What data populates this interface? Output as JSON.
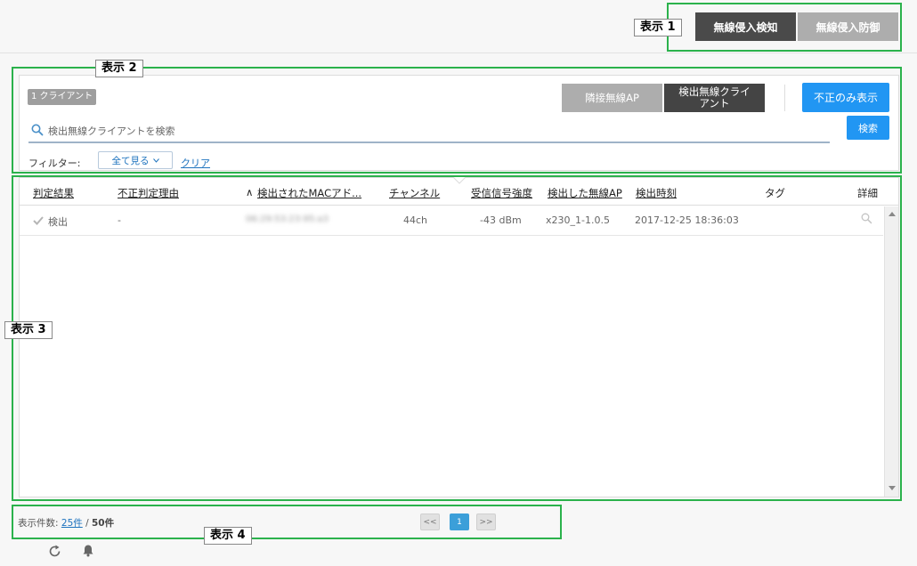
{
  "callouts": {
    "c1": "表示 1",
    "c2": "表示 2",
    "c3": "表示 3",
    "c4": "表示 4"
  },
  "header": {
    "ids_button": "無線侵入検知",
    "ips_button": "無線侵入防御"
  },
  "search_panel": {
    "client_count": "1 クライアント",
    "tab_neighbor_ap": "隣接無線AP",
    "tab_detected_client": "検出無線クライアント",
    "rogue_only_button": "不正のみ表示",
    "search_placeholder": "検出無線クライアントを検索",
    "search_button": "検索",
    "filter_label": "フィルター:",
    "filter_value": "全て見る",
    "clear_link": "クリア"
  },
  "table": {
    "columns": [
      "判定結果",
      "不正判定理由",
      "検出されたMACアド...",
      "チャンネル",
      "受信信号強度",
      "検出した無線AP",
      "検出時刻",
      "タグ",
      "詳細"
    ],
    "sort_indicator": "∧",
    "rows": [
      {
        "result": "検出",
        "reason": "-",
        "mac": "06:29:53:23:95:a3",
        "channel": "44ch",
        "rssi": "-43 dBm",
        "ap": "x230_1-1.0.5",
        "time": "2017-12-25 18:36:03"
      }
    ]
  },
  "footer": {
    "per_page_label": "表示件数:",
    "per_page_value": "25件",
    "separator": " / ",
    "total": "50件",
    "prev": "<<",
    "page": "1",
    "next": ">>"
  },
  "colors": {
    "annotation_green": "#2bb24c",
    "primary_blue": "#2196f3",
    "dark_button": "#4a4a4a",
    "light_button": "#adadad"
  },
  "icons": [
    "search-icon",
    "check-icon",
    "chevron-down-icon",
    "magnifier-icon",
    "refresh-icon",
    "bell-icon",
    "scroll-up-icon",
    "scroll-down-icon"
  ]
}
